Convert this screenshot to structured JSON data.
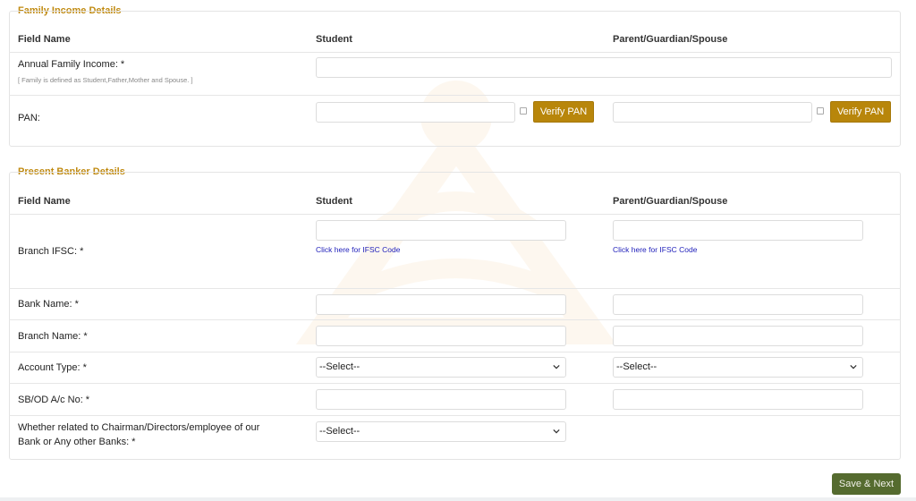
{
  "family_income": {
    "title": "Family Income Details",
    "headers": {
      "field": "Field Name",
      "student": "Student",
      "parent": "Parent/Guardian/Spouse"
    },
    "annual_income_label": "Annual Family Income: *",
    "annual_income_note": "[ Family is defined as Student,Father,Mother and Spouse. ]",
    "pan_label": "PAN:",
    "verify_student": "Verify PAN",
    "verify_parent": "Verify PAN"
  },
  "banker": {
    "title": "Present Banker Details",
    "headers": {
      "field": "Field Name",
      "student": "Student",
      "parent": "Parent/Guardian/Spouse"
    },
    "ifsc_label": "Branch IFSC: *",
    "ifsc_link_student": "Click here for IFSC Code",
    "ifsc_link_parent": "Click here for IFSC Code",
    "bank_name_label": "Bank Name: *",
    "branch_name_label": "Branch Name: *",
    "account_type_label": "Account Type: *",
    "account_type_student": "--Select--",
    "account_type_parent": "--Select--",
    "acno_label": "SB/OD A/c No: *",
    "related_label_line1": "Whether related to Chairman/Directors/employee of our",
    "related_label_line2": "Bank or Any other Banks: *",
    "related_value": "--Select--"
  },
  "actions": {
    "save_next": "Save & Next"
  },
  "colors": {
    "section_title": "#c08a10",
    "verify_button": "#b8860b",
    "save_button": "#556b2f",
    "link": "#2222bb"
  },
  "icons": {
    "dropdown": "chevron-down-icon"
  }
}
